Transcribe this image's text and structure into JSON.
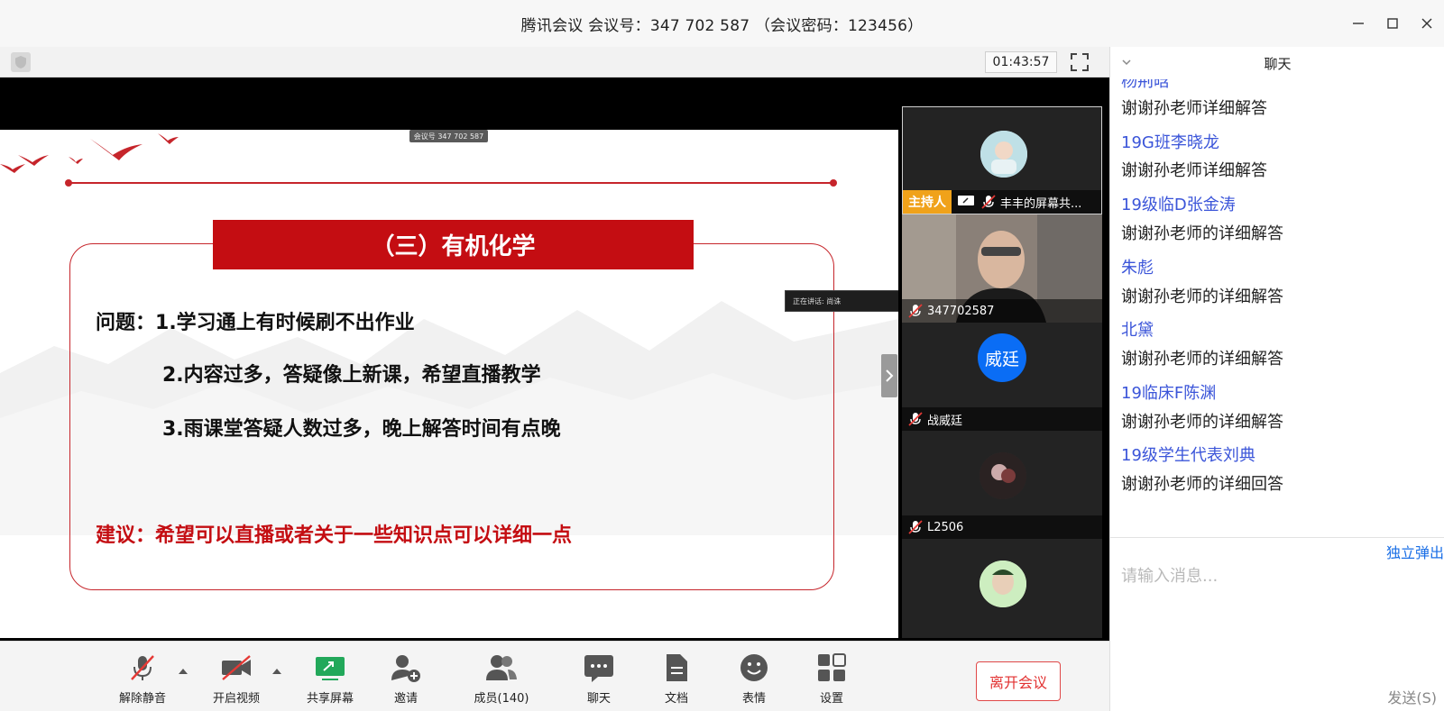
{
  "window": {
    "title": "腾讯会议 会议号：347 702 587 （会议密码：123456）"
  },
  "meeting": {
    "timer": "01:43:57",
    "meeting_tag": "会议号 347 702 587",
    "speaking_label": "正在讲话: 尚诛"
  },
  "slide": {
    "heading": "（三）有机化学",
    "question_prefix": "问题：",
    "q1": "1.学习通上有时候刷不出作业",
    "q2": "2.内容过多，答疑像上新课，希望直播教学",
    "q3": "3.雨课堂答疑人数过多，晚上解答时间有点晚",
    "suggestion": "建议：希望可以直播或者关于一些知识点可以详细一点",
    "accent_color": "#c40d12"
  },
  "participants": [
    {
      "name": "丰丰的屏幕共...",
      "host_label": "主持人",
      "muted": true
    },
    {
      "name": "347702587",
      "muted": true
    },
    {
      "name": "战威廷",
      "avatar_text": "威廷",
      "muted": true
    },
    {
      "name": "L2506",
      "muted": true
    },
    {
      "name": "",
      "muted": true
    }
  ],
  "toolbar": {
    "unmute": "解除静音",
    "start_video": "开启视频",
    "share_screen": "共享屏幕",
    "invite": "邀请",
    "members": "成员(140)",
    "chat": "聊天",
    "docs": "文档",
    "emoji": "表情",
    "settings": "设置",
    "leave": "离开会议"
  },
  "chat": {
    "title": "聊天",
    "partial_sender": "杨荆晗",
    "messages": [
      {
        "sender": "",
        "text": "谢谢孙老师详细解答"
      },
      {
        "sender": "19G班李晓龙",
        "text": "谢谢孙老师详细解答"
      },
      {
        "sender": "19级临D张金涛",
        "text": "谢谢孙老师的详细解答"
      },
      {
        "sender": "朱彪",
        "text": "谢谢孙老师的详细解答"
      },
      {
        "sender": "北黛",
        "text": "谢谢孙老师的详细解答"
      },
      {
        "sender": "19临床F陈渊",
        "text": "谢谢孙老师的详细解答"
      },
      {
        "sender": "19级学生代表刘典",
        "text": "谢谢孙老师的详细回答"
      }
    ],
    "popout": "独立弹出",
    "input_placeholder": "请输入消息...",
    "send": "发送(S)"
  }
}
